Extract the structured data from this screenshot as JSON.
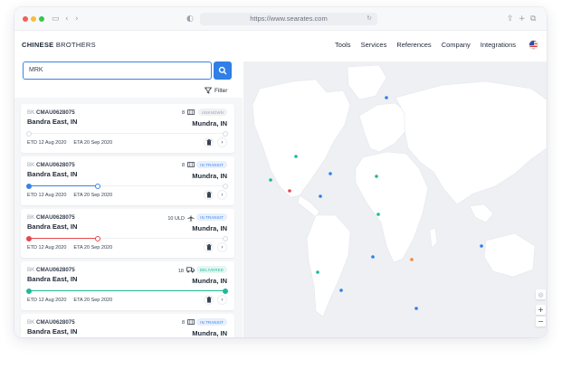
{
  "browser": {
    "url": "https://www.searates.com",
    "traffic_colors": [
      "#f25f58",
      "#f8be3c",
      "#38c74a"
    ]
  },
  "nav": {
    "brand_bold": "CHINESE",
    "brand_light": " BROTHERS",
    "links": [
      "Tools",
      "Services",
      "References",
      "Company",
      "Integrations"
    ],
    "flag": "us-flag"
  },
  "search": {
    "value": "MRK",
    "button_icon": "search-icon"
  },
  "filter": {
    "label": "Filter",
    "icon": "filter-icon"
  },
  "shipments": [
    {
      "booking_prefix": "BK",
      "booking_id": "CMAU0628075",
      "container": "8",
      "transport_icon": "container-icon",
      "status": "UNKNOWN",
      "status_color": "#9ca3af",
      "status_bg": "#f0f1f3",
      "origin": "Bandra East, IN",
      "destination": "Mundra, IN",
      "etd": "ETD 12 Aug 2020",
      "eta": "ETA 20 Sep 2020",
      "progress": 0,
      "track_color": "#d7dbe1"
    },
    {
      "booking_prefix": "BK",
      "booking_id": "CMAU0628075",
      "container": "8",
      "transport_icon": "container-icon",
      "status": "IN TRANSIT",
      "status_color": "#3b82e6",
      "status_bg": "#e7f0fd",
      "origin": "Bandra East, IN",
      "destination": "Mundra, IN",
      "etd": "ETD 12 Aug 2020",
      "eta": "ETA 20 Sep 2020",
      "progress": 0.35,
      "track_color": "#3b82e6"
    },
    {
      "booking_prefix": "BK",
      "booking_id": "CMAU0628075",
      "container": "10 ULD",
      "transport_icon": "plane-icon",
      "status": "IN TRANSIT",
      "status_color": "#3b82e6",
      "status_bg": "#e7f0fd",
      "origin": "Bandra East, IN",
      "destination": "Mundra, IN",
      "etd": "ETD 12 Aug 2020",
      "eta": "ETA 20 Sep 2020",
      "progress": 0.35,
      "track_color": "#e5484d"
    },
    {
      "booking_prefix": "BK",
      "booking_id": "CMAU0628075",
      "container": "18",
      "transport_icon": "truck-icon",
      "status": "DELIVERED",
      "status_color": "#1fb89a",
      "status_bg": "#e3f7f2",
      "origin": "Bandra East, IN",
      "destination": "Mundra, IN",
      "etd": "ETD 12 Aug 2020",
      "eta": "ETA 20 Sep 2020",
      "progress": 1,
      "track_color": "#1fb89a"
    },
    {
      "booking_prefix": "BK",
      "booking_id": "CMAU0628075",
      "container": "8",
      "transport_icon": "container-icon",
      "status": "IN TRANSIT",
      "status_color": "#3b82e6",
      "status_bg": "#e7f0fd",
      "origin": "Bandra East, IN",
      "destination": "Mundra, IN",
      "etd": "ETD 12 Aug 2020",
      "eta": "ETA 20 Sep 2020",
      "progress": 0.35,
      "track_color": "#3b82e6"
    }
  ],
  "map": {
    "controls": [
      "locate-icon",
      "zoom-in-icon",
      "zoom-out-icon"
    ],
    "zoom_in": "+",
    "zoom_out": "−",
    "marker_colors": {
      "blue": "#2f7fe6",
      "green": "#1fb89a",
      "red": "#e5484d",
      "orange": "#f08a3c"
    }
  }
}
